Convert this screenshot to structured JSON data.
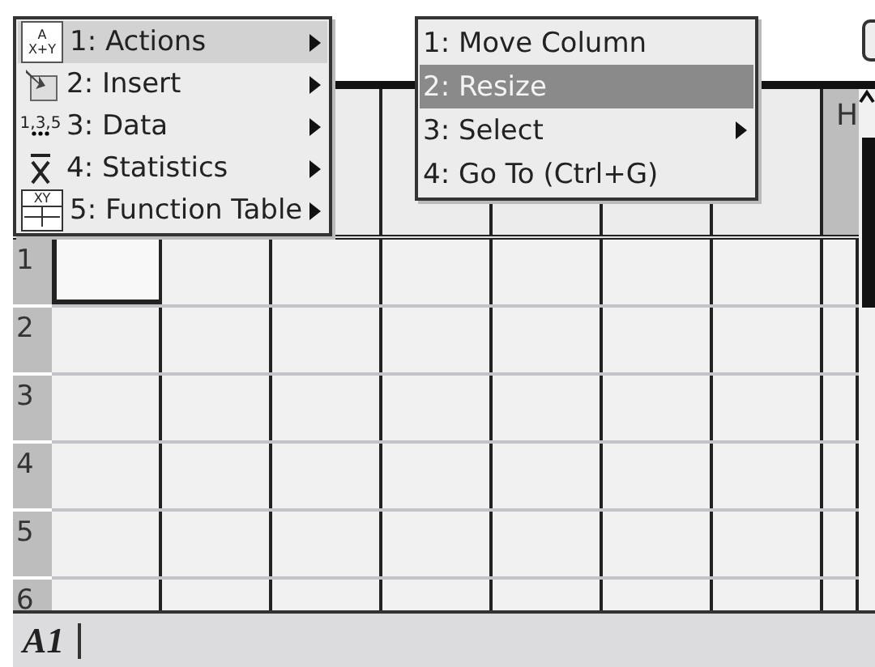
{
  "menu": {
    "items": [
      {
        "label": "1: Actions",
        "kind": "actions",
        "icon_text": [
          "A",
          "X+Y"
        ],
        "has_submenu": true,
        "selected": true
      },
      {
        "label": "2: Insert",
        "kind": "insert",
        "has_submenu": true,
        "selected": false
      },
      {
        "label": "3: Data",
        "kind": "data",
        "icon_text": [
          "1,3,5"
        ],
        "has_submenu": true,
        "selected": false
      },
      {
        "label": "4: Statistics",
        "kind": "statistics",
        "has_submenu": true,
        "selected": false
      },
      {
        "label": "5: Function Table",
        "kind": "function-table",
        "icon_text": [
          "XY"
        ],
        "has_submenu": true,
        "selected": false
      }
    ]
  },
  "submenu": {
    "items": [
      {
        "label": "1: Move Column",
        "has_submenu": false,
        "selected": false
      },
      {
        "label": "2: Resize",
        "has_submenu": false,
        "selected": true
      },
      {
        "label": "3: Select",
        "has_submenu": true,
        "selected": false
      },
      {
        "label": "4: Go To (Ctrl+G)",
        "has_submenu": false,
        "selected": false
      }
    ]
  },
  "spreadsheet": {
    "visible_column_header": "H",
    "rows": [
      {
        "label": "1",
        "selected": true
      },
      {
        "label": "2",
        "selected": false
      },
      {
        "label": "3",
        "selected": false
      },
      {
        "label": "4",
        "selected": false
      },
      {
        "label": "5",
        "selected": false
      },
      {
        "label": "6",
        "selected": false
      }
    ]
  },
  "entry_line": {
    "value": "A1"
  }
}
